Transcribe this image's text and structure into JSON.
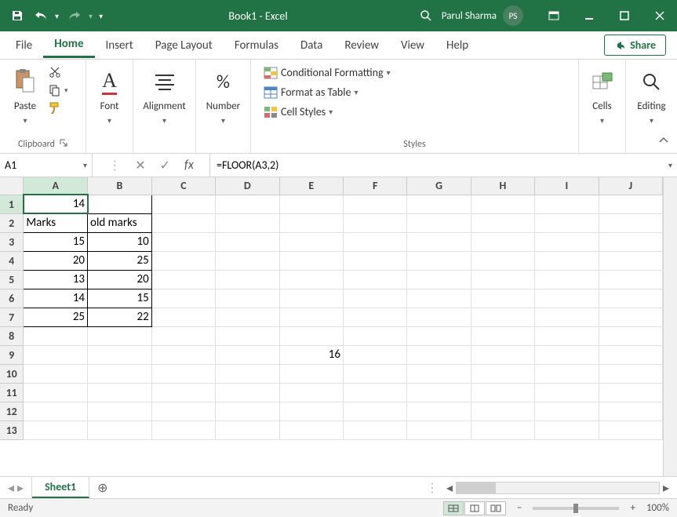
{
  "title": "Book1  -  Excel",
  "user": {
    "name": "Parul Sharma",
    "initials": "PS"
  },
  "tabs": {
    "file": "File",
    "home": "Home",
    "insert": "Insert",
    "page_layout": "Page Layout",
    "formulas": "Formulas",
    "data": "Data",
    "review": "Review",
    "view": "View",
    "help": "Help"
  },
  "share": "Share",
  "ribbon": {
    "clipboard": {
      "paste": "Paste",
      "label": "Clipboard"
    },
    "font": {
      "label": "Font"
    },
    "alignment": {
      "label": "Alignment"
    },
    "number": {
      "label": "Number"
    },
    "styles": {
      "cond": "Conditional Formatting",
      "table": "Format as Table",
      "cellstyles": "Cell Styles",
      "label": "Styles"
    },
    "cells": {
      "label": "Cells"
    },
    "editing": {
      "label": "Editing"
    }
  },
  "name_box": "A1",
  "formula": "=FLOOR(A3,2)",
  "columns": [
    "A",
    "B",
    "C",
    "D",
    "E",
    "F",
    "G",
    "H",
    "I",
    "J"
  ],
  "rows": [
    "1",
    "2",
    "3",
    "4",
    "5",
    "6",
    "7",
    "8",
    "9",
    "10",
    "11",
    "12",
    "13"
  ],
  "cells": {
    "A1": "14",
    "A2": "Marks",
    "B2": "old marks",
    "A3": "15",
    "B3": "10",
    "A4": "20",
    "B4": "25",
    "A5": "13",
    "B5": "20",
    "A6": "14",
    "B6": "15",
    "A7": "25",
    "B7": "22",
    "E9": "16"
  },
  "sheet": "Sheet1",
  "status": "Ready",
  "zoom": "100%"
}
